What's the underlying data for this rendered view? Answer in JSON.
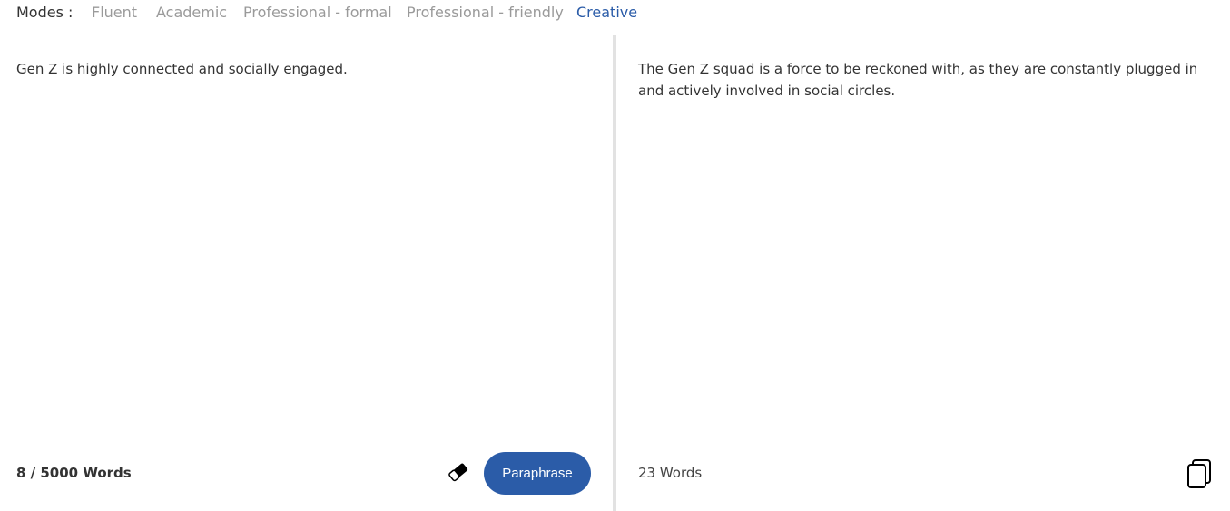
{
  "modes": {
    "label": "Modes :",
    "tabs": [
      {
        "label": "Fluent",
        "active": false
      },
      {
        "label": "Academic",
        "active": false
      },
      {
        "label": "Professional - formal",
        "active": false
      },
      {
        "label": "Professional - friendly",
        "active": false
      },
      {
        "label": "Creative",
        "active": true
      }
    ]
  },
  "input": {
    "text": "Gen Z is highly connected and socially engaged.",
    "word_count": "8 / 5000 Words",
    "clear_icon": "eraser-icon",
    "paraphrase_label": "Paraphrase"
  },
  "output": {
    "text": "The Gen Z squad is a force to be reckoned with, as they are constantly plugged in and actively involved in social circles.",
    "word_count": "23 Words",
    "copy_icon": "copy-icon"
  },
  "colors": {
    "accent": "#2b5ca8",
    "inactive_tab": "#9a9a9a",
    "divider": "#e2e2e2"
  }
}
